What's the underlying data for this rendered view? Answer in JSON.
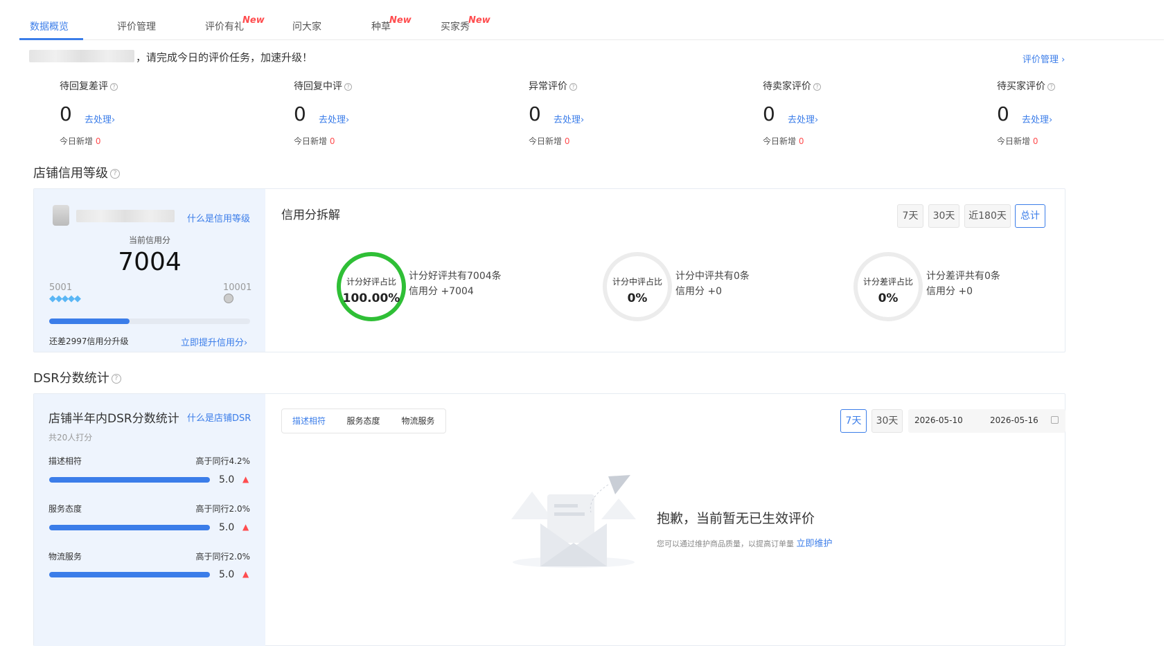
{
  "tabs": [
    {
      "label": "数据概览",
      "new": ""
    },
    {
      "label": "评价管理",
      "new": ""
    },
    {
      "label": "评价有礼",
      "new": "New"
    },
    {
      "label": "问大家",
      "new": ""
    },
    {
      "label": "种草",
      "new": "New"
    },
    {
      "label": "买家秀",
      "new": "New"
    }
  ],
  "notice": {
    "text": "，请完成今日的评价任务，加速升级！",
    "link": "评价管理 ›"
  },
  "stats": [
    {
      "label": "待回复差评",
      "value": "0",
      "action": "去处理›",
      "sub_label": "今日新增",
      "sub_value": "0"
    },
    {
      "label": "待回复中评",
      "value": "0",
      "action": "去处理›",
      "sub_label": "今日新增",
      "sub_value": "0"
    },
    {
      "label": "异常评价",
      "value": "0",
      "action": "去处理›",
      "sub_label": "今日新增",
      "sub_value": "0"
    },
    {
      "label": "待卖家评价",
      "value": "0",
      "action": "去处理›",
      "sub_label": "今日新增",
      "sub_value": "0"
    },
    {
      "label": "待买家评价",
      "value": "0",
      "action": "去处理›",
      "sub_label": "今日新增",
      "sub_value": "0"
    }
  ],
  "credit": {
    "section_title": "店铺信用等级",
    "what_link": "什么是信用等级",
    "current_label": "当前信用分",
    "score": "7004",
    "min": "5001",
    "max": "10001",
    "progress": 0.4,
    "gap_text": "还差2997信用分升级",
    "boost_link": "立即提升信用分›",
    "breakdown_title": "信用分拆解",
    "ranges": [
      "7天",
      "30天",
      "近180天",
      "总计"
    ],
    "active_range": 3,
    "rings": [
      {
        "title": "计分好评占比",
        "value": "100.00%",
        "line1": "计分好评共有7004条",
        "line2": "信用分 +7004",
        "color": "#2fbf36"
      },
      {
        "title": "计分中评占比",
        "value": "0%",
        "line1": "计分中评共有0条",
        "line2": "信用分 +0",
        "color": "#ececec"
      },
      {
        "title": "计分差评占比",
        "value": "0%",
        "line1": "计分差评共有0条",
        "line2": "信用分 +0",
        "color": "#ececec"
      }
    ]
  },
  "dsr": {
    "section_title": "DSR分数统计",
    "card_title": "店铺半年内DSR分数统计",
    "what_link": "什么是店铺DSR",
    "count_text": "共20人打分",
    "items": [
      {
        "label": "描述相符",
        "compare": "高于同行4.2%",
        "score": "5.0",
        "fill": 1.0
      },
      {
        "label": "服务态度",
        "compare": "高于同行2.0%",
        "score": "5.0",
        "fill": 1.0
      },
      {
        "label": "物流服务",
        "compare": "高于同行2.0%",
        "score": "5.0",
        "fill": 1.0
      }
    ],
    "seg_tabs": [
      "描述相符",
      "服务态度",
      "物流服务"
    ],
    "ranges": [
      "7天",
      "30天"
    ],
    "date_start": "2026-05-10",
    "date_end": "2026-05-16",
    "empty_title": "抱歉，当前暂无已生效评价",
    "empty_desc": "您可以通过维护商品质量，以提高订单量",
    "empty_link": "立即维护"
  },
  "icons": [
    "question-icon",
    "diamond-icon",
    "crown-icon",
    "calendar-icon",
    "up-arrow-icon",
    "envelope-illustration"
  ]
}
